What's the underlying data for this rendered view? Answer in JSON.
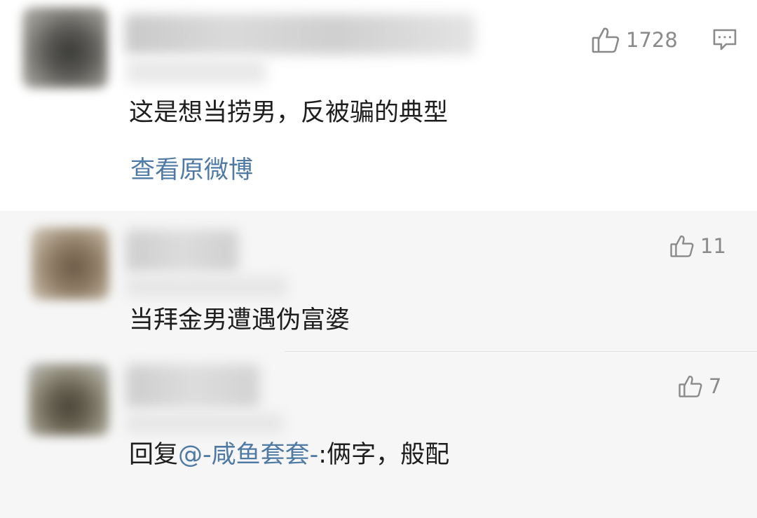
{
  "main_comment": {
    "likes": "1728",
    "text": "这是想当捞男，反被骗的典型",
    "view_original_link": "查看原微博"
  },
  "replies": [
    {
      "likes": "11",
      "text": "当拜金男遭遇伪富婆"
    },
    {
      "likes": "7",
      "reply_prefix": "回复",
      "mention": "@-咸鱼套套-",
      "text_after": ":俩字，般配"
    }
  ],
  "icons": {
    "like": "thumbs-up-icon",
    "comment": "comment-bubble-icon"
  },
  "colors": {
    "link": "#4f7aa5",
    "icon_gray": "#8a8a8a",
    "reply_background": "#f6f6f6"
  }
}
